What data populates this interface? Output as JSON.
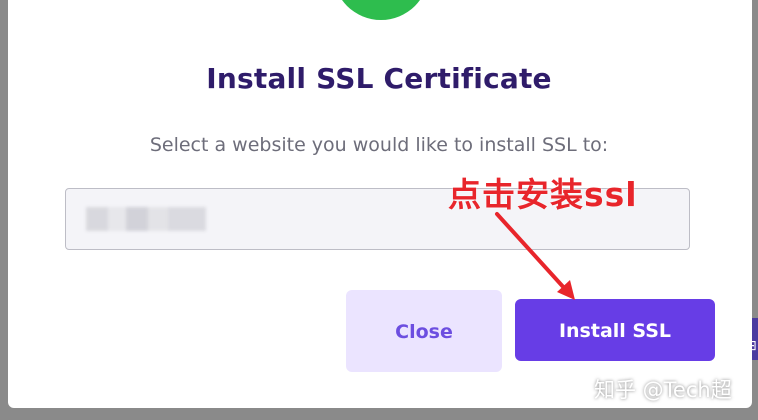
{
  "modal": {
    "title": "Install SSL Certificate",
    "subtitle": "Select a website you would like to install SSL to:",
    "select_value": "",
    "close_label": "Close",
    "install_label": "Install SSL"
  },
  "annotation": {
    "text": "点击安装ssl",
    "color": "#e8252b"
  },
  "watermark": {
    "text": "知乎 @Tech超"
  },
  "colors": {
    "accent": "#673de6",
    "success": "#2ebd4e",
    "title": "#2f1c6a",
    "secondary_button_bg": "#ebe4ff"
  }
}
